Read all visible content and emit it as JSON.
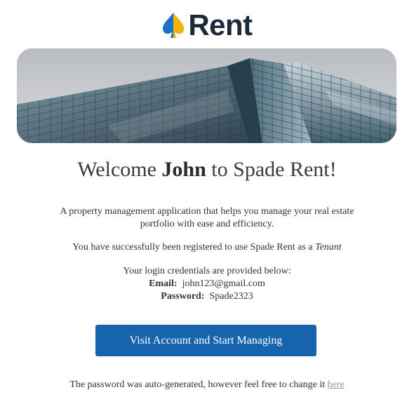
{
  "logo": {
    "text": "Rent",
    "icon": "spade-icon",
    "colors": {
      "spade_blue": "#1a73c8",
      "spade_yellow": "#f5b301",
      "text": "#1b2a3a"
    }
  },
  "hero": {
    "image": "glass-skyscrapers-photo"
  },
  "welcome": {
    "prefix": "Welcome",
    "name": "John",
    "suffix": "to Spade Rent!"
  },
  "intro": {
    "text": "A property management application that helps you manage your real estate portfolio with ease and efficiency."
  },
  "registration": {
    "text": "You have successfully been registered to use Spade Rent as a",
    "role": "Tenant"
  },
  "credentials": {
    "heading": "Your login credentials are provided below:",
    "email_label": "Email:",
    "email_value": "john123@gmail.com",
    "password_label": "Password:",
    "password_value": "Spade2323"
  },
  "cta": {
    "label": "Visit Account and Start Managing",
    "color": "#1764ae"
  },
  "footer": {
    "text": "The password was auto-generated, however feel free to change it",
    "link_label": "here"
  }
}
